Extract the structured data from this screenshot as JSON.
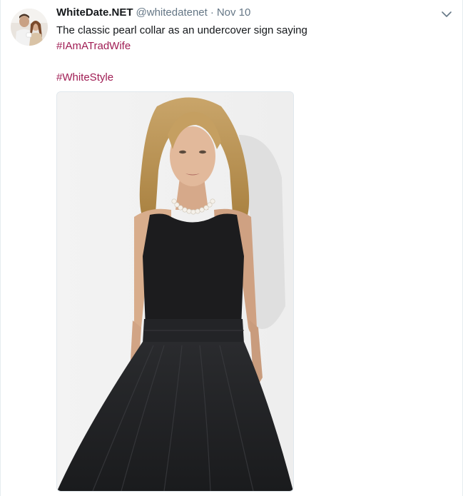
{
  "tweet": {
    "display_name": "WhiteDate.NET",
    "handle": "@whitedatenet",
    "separator": "·",
    "date": "Nov 10",
    "text_line1": "The classic pearl collar as an undercover sign saying",
    "hashtag1": "#IAmATradWife",
    "hashtag2": "#WhiteStyle"
  },
  "colors": {
    "hashtag": "#a01d54",
    "name": "#14171a",
    "meta": "#657786"
  },
  "icons": {
    "caret": "chevron-down-icon"
  }
}
